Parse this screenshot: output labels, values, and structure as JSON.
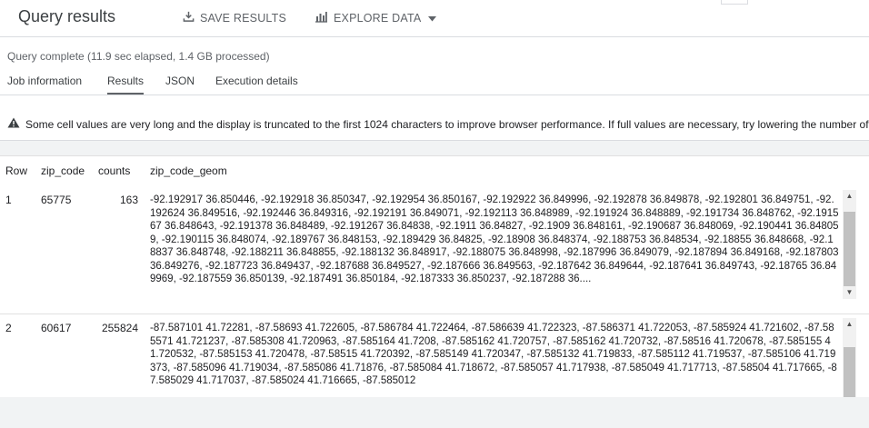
{
  "header": {
    "title": "Query results",
    "save_label": "SAVE RESULTS",
    "explore_label": "EXPLORE DATA"
  },
  "status": "Query complete (11.9 sec elapsed, 1.4 GB processed)",
  "tabs": [
    {
      "label": "Job information",
      "active": false
    },
    {
      "label": "Results",
      "active": true
    },
    {
      "label": "JSON",
      "active": false
    },
    {
      "label": "Execution details",
      "active": false
    }
  ],
  "warning": "Some cell values are very long and the display is truncated to the first 1024 characters to improve browser performance. If full values are necessary, try lowering the number of",
  "table": {
    "columns": [
      "Row",
      "zip_code",
      "counts",
      "zip_code_geom"
    ],
    "rows": [
      {
        "row": "1",
        "zip_code": "65775",
        "counts": "163",
        "zip_code_geom": "-92.192917 36.850446, -92.192918 36.850347, -92.192954 36.850167, -92.192922 36.849996, -92.192878 36.849878, -92.192801 36.849751, -92.192624 36.849516, -92.192446 36.849316, -92.192191 36.849071, -92.192113 36.848989, -92.191924 36.848889, -92.191734 36.848762, -92.191567 36.848643, -92.191378 36.848489, -92.191267 36.84838, -92.1911 36.84827, -92.1909 36.848161, -92.190687 36.848069, -92.190441 36.848059, -92.190115 36.848074, -92.189767 36.848153, -92.189429 36.84825, -92.18908 36.848374, -92.188753 36.848534, -92.18855 36.848668, -92.18837 36.848748, -92.188211 36.848855, -92.188132 36.848917, -92.188075 36.848998, -92.187996 36.849079, -92.187894 36.849168, -92.187803 36.849276, -92.187723 36.849437, -92.187688 36.849527, -92.187666 36.849563, -92.187642 36.849644, -92.187641 36.849743, -92.18765 36.849969, -92.187559 36.850139, -92.187491 36.850184, -92.187333 36.850237, -92.187288 36...."
      },
      {
        "row": "2",
        "zip_code": "60617",
        "counts": "255824",
        "zip_code_geom": "-87.587101 41.72281, -87.58693 41.722605, -87.586784 41.722464, -87.586639 41.722323, -87.586371 41.722053, -87.585924 41.721602, -87.585571 41.721237, -87.585308 41.720963, -87.585164 41.7208, -87.585162 41.720757, -87.585162 41.720732, -87.58516 41.720678, -87.585155 41.720532, -87.585153 41.720478, -87.58515 41.720392, -87.585149 41.720347, -87.585132 41.719833, -87.585112 41.719537, -87.585106 41.719373, -87.585096 41.719034, -87.585086 41.71876, -87.585084 41.718672, -87.585057 41.717938, -87.585049 41.717713, -87.58504 41.717665, -87.585029 41.717037, -87.585024 41.716665, -87.585012"
      }
    ]
  },
  "icons": {
    "save": "download-icon",
    "explore": "bar-chart-icon",
    "warning": "warning-triangle-icon"
  }
}
